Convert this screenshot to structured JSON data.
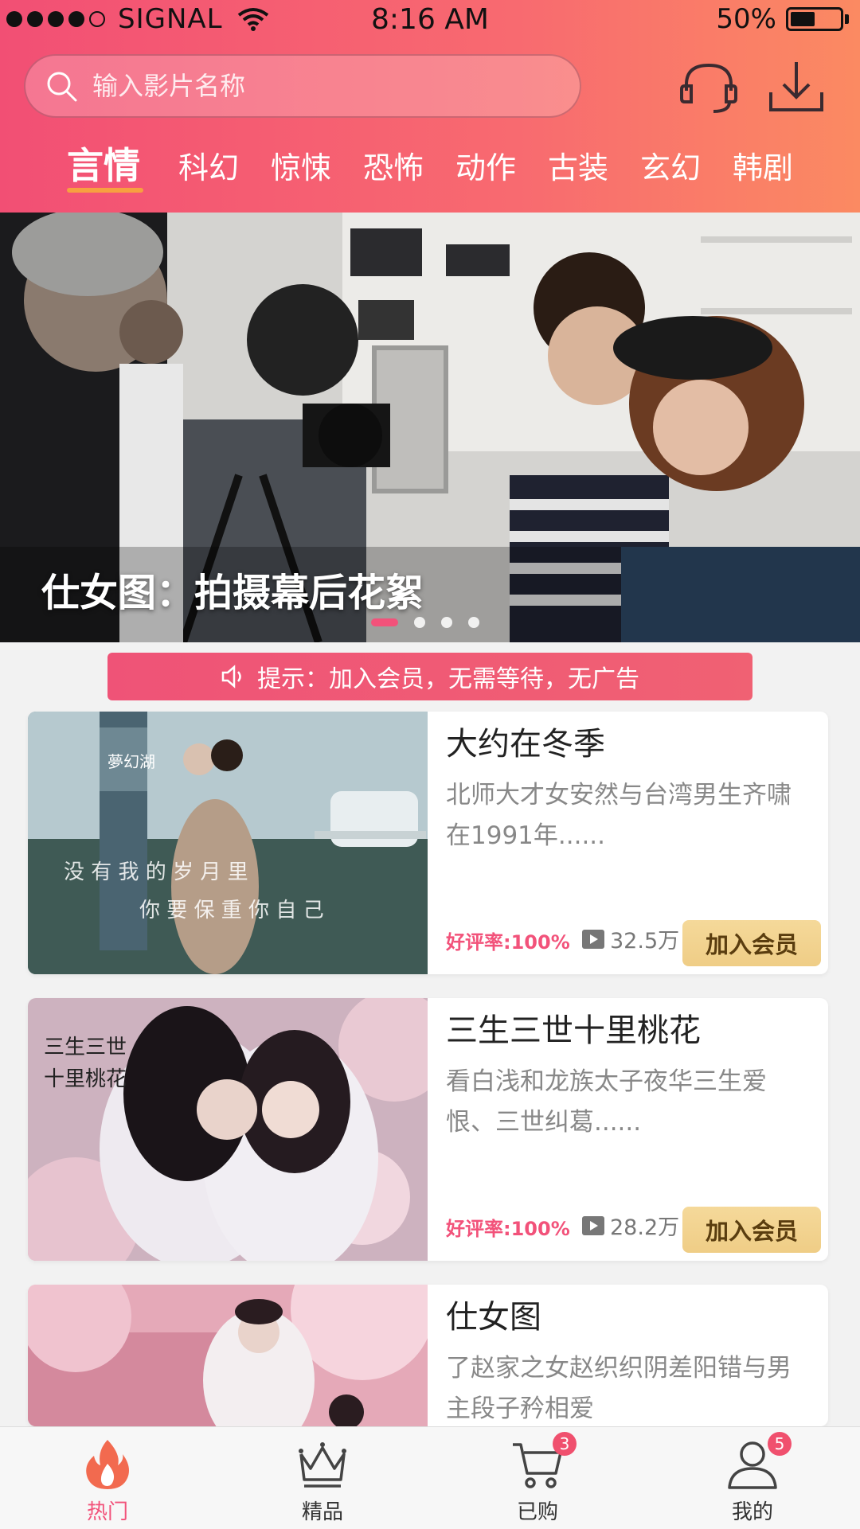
{
  "status_bar": {
    "carrier": "SIGNAL",
    "time": "8:16 AM",
    "battery": "50%",
    "battery_level": 0.5
  },
  "search": {
    "placeholder": "输入影片名称"
  },
  "header_icons": [
    "headset-icon",
    "download-icon"
  ],
  "category_tabs": [
    {
      "label": "言情",
      "active": true
    },
    {
      "label": "科幻"
    },
    {
      "label": "惊悚"
    },
    {
      "label": "恐怖"
    },
    {
      "label": "动作"
    },
    {
      "label": "古装"
    },
    {
      "label": "玄幻"
    },
    {
      "label": "韩剧"
    }
  ],
  "banner": {
    "title": "仕女图：拍摄幕后花絮",
    "slide_count": 4,
    "active_slide": 1
  },
  "notice": {
    "text": "提示：加入会员，无需等待，无广告"
  },
  "movies": [
    {
      "title": "大约在冬季",
      "desc": "北师大才女安然与台湾男生齐啸在1991年......",
      "rating": "好评率:100%",
      "views": "32.5万",
      "button": "加入会员",
      "poster_text": [
        "夢幻湖",
        "没 有 我 的 岁 月 里",
        "你 要 保 重 你 自 己"
      ]
    },
    {
      "title": "三生三世十里桃花",
      "desc": "看白浅和龙族太子夜华三生爱恨、三世纠葛......",
      "rating": "好评率:100%",
      "views": "28.2万",
      "button": "加入会员",
      "poster_text": [
        "三生三世",
        "十里桃花"
      ]
    },
    {
      "title": "仕女图",
      "desc": "了赵家之女赵织织阴差阳错与男主段子矜相爱",
      "rating": "",
      "views": "",
      "button": "",
      "poster_text": []
    }
  ],
  "tabbar": [
    {
      "label": "热门",
      "icon": "flame-icon",
      "active": true,
      "badge": ""
    },
    {
      "label": "精品",
      "icon": "crown-icon",
      "badge": ""
    },
    {
      "label": "已购",
      "icon": "cart-icon",
      "badge": "3"
    },
    {
      "label": "我的",
      "icon": "user-icon",
      "badge": "5"
    }
  ],
  "colors": {
    "accent": "#f2527a",
    "header_gradient_start": "#f24f74",
    "header_gradient_end": "#fb8a62",
    "tab_underline": "#f7a040",
    "vip_button": "#f5d99a"
  }
}
